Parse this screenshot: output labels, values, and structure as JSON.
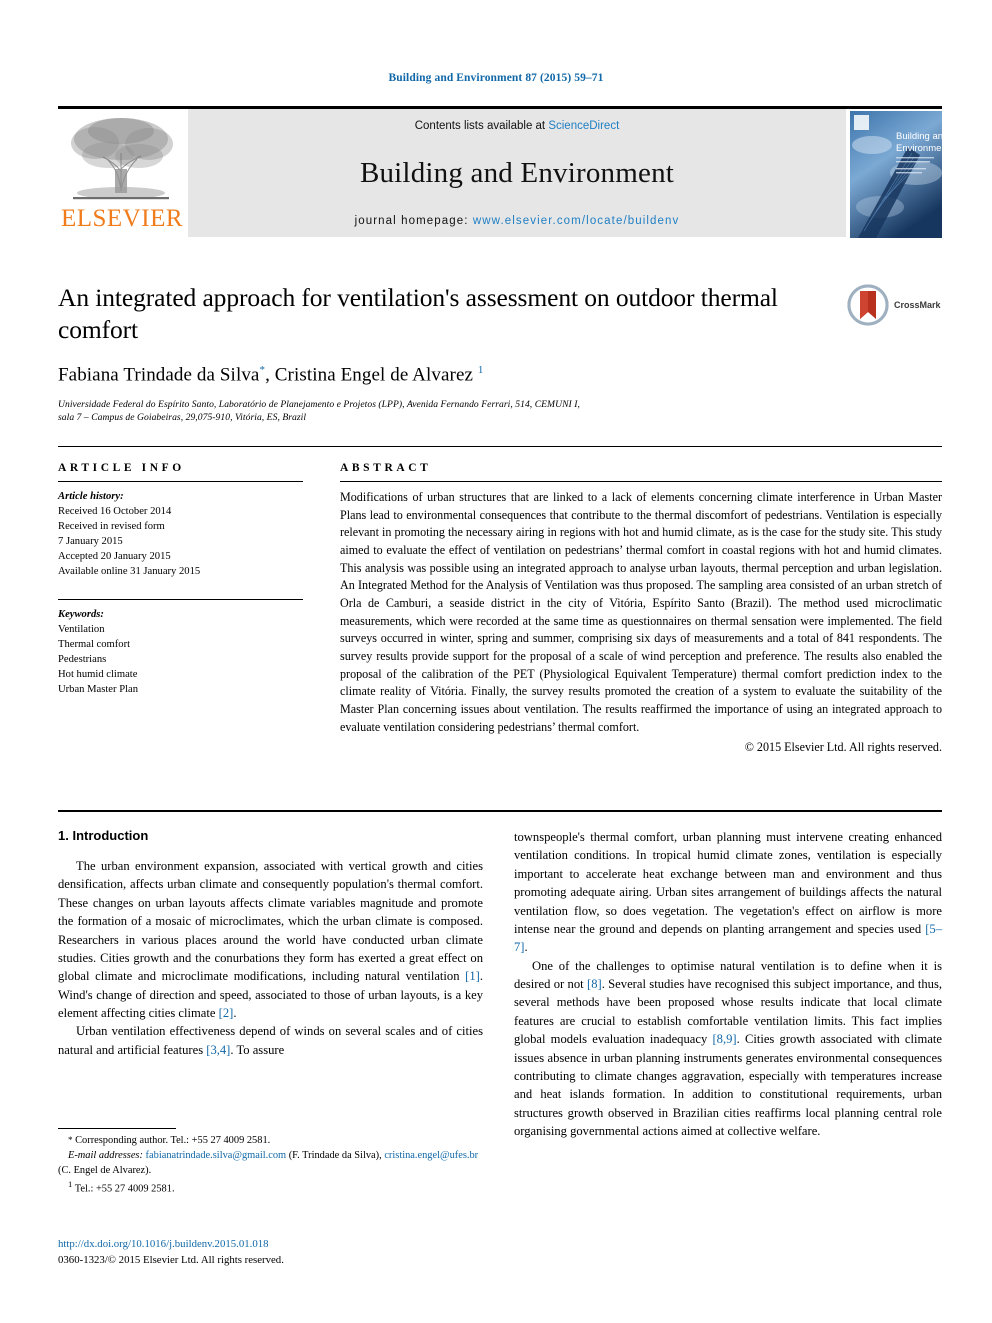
{
  "running_head": "Building and Environment 87 (2015) 59–71",
  "masthead": {
    "publisher_name": "ELSEVIER",
    "contents_prefix": "Contents lists available at ",
    "contents_link": "ScienceDirect",
    "journal_title": "Building and Environment",
    "homepage_prefix": "journal homepage: ",
    "homepage_url": "www.elsevier.com/locate/buildenv",
    "cover_title_line1": "Building and",
    "cover_title_line2": "Environment",
    "accent_color": "#1f7fc4",
    "elsevier_orange": "#f07c1b"
  },
  "title": {
    "text": "An integrated approach for ventilation's assessment on outdoor thermal comfort",
    "crossmark_label": "CrossMark"
  },
  "authors": {
    "author1": "Fabiana Trindade da Silva",
    "author1_mark": "*",
    "separator": ", ",
    "author2": "Cristina Engel de Alvarez",
    "author2_mark": "1",
    "affiliation_line1": "Universidade Federal do Espírito Santo, Laboratório de Planejamento e Projetos (LPP), Avenida Fernando Ferrari, 514, CEMUNI I,",
    "affiliation_line2": "sala 7 – Campus de Goiabeiras, 29,075-910, Vitória, ES, Brazil"
  },
  "article_info": {
    "heading": "ARTICLE INFO",
    "history_label": "Article history:",
    "history": [
      "Received 16 October 2014",
      "Received in revised form",
      "7 January 2015",
      "Accepted 20 January 2015",
      "Available online 31 January 2015"
    ],
    "keywords_label": "Keywords:",
    "keywords": [
      "Ventilation",
      "Thermal comfort",
      "Pedestrians",
      "Hot humid climate",
      "Urban Master Plan"
    ]
  },
  "abstract": {
    "heading": "ABSTRACT",
    "text": "Modifications of urban structures that are linked to a lack of elements concerning climate interference in Urban Master Plans lead to environmental consequences that contribute to the thermal discomfort of pedestrians. Ventilation is especially relevant in promoting the necessary airing in regions with hot and humid climate, as is the case for the study site. This study aimed to evaluate the effect of ventilation on pedestrians’ thermal comfort in coastal regions with hot and humid climates. This analysis was possible using an integrated approach to analyse urban layouts, thermal perception and urban legislation. An Integrated Method for the Analysis of Ventilation was thus proposed. The sampling area consisted of an urban stretch of Orla de Camburi, a seaside district in the city of Vitória, Espírito Santo (Brazil). The method used microclimatic measurements, which were recorded at the same time as questionnaires on thermal sensation were implemented. The field surveys occurred in winter, spring and summer, comprising six days of measurements and a total of 841 respondents. The survey results provide support for the proposal of a scale of wind perception and preference. The results also enabled the proposal of the calibration of the PET (Physiological Equivalent Temperature) thermal comfort prediction index to the climate reality of Vitória. Finally, the survey results promoted the creation of a system to evaluate the suitability of the Master Plan concerning issues about ventilation. The results reaffirmed the importance of using an integrated approach to evaluate ventilation considering pedestrians’ thermal comfort.",
    "copyright": "© 2015 Elsevier Ltd. All rights reserved."
  },
  "introduction": {
    "heading": "1. Introduction",
    "left_paragraphs": [
      "The urban environment expansion, associated with vertical growth and cities densification, affects urban climate and consequently population's thermal comfort. These changes on urban layouts affects climate variables magnitude and promote the formation of a mosaic of microclimates, which the urban climate is composed. Researchers in various places around the world have conducted urban climate studies. Cities growth and the conurbations they form has exerted a great effect on global climate and microclimate modifications, including natural ventilation [1]. Wind's change of direction and speed, associated to those of urban layouts, is a key element affecting cities climate [2].",
      "Urban ventilation effectiveness depend of winds on several scales and of cities natural and artificial features [3,4]. To assure"
    ],
    "right_paragraphs": [
      "townspeople's thermal comfort, urban planning must intervene creating enhanced ventilation conditions. In tropical humid climate zones, ventilation is especially important to accelerate heat exchange between man and environment and thus promoting adequate airing. Urban sites arrangement of buildings affects the natural ventilation flow, so does vegetation. The vegetation's effect on airflow is more intense near the ground and depends on planting arrangement and species used [5–7].",
      "One of the challenges to optimise natural ventilation is to define when it is desired or not [8]. Several studies have recognised this subject importance, and thus, several methods have been proposed whose results indicate that local climate features are crucial to establish comfortable ventilation limits. This fact implies global models evaluation inadequacy [8,9]. Cities growth associated with climate issues absence in urban planning instruments generates environmental consequences contributing to climate changes aggravation, especially with temperatures increase and heat islands formation. In addition to constitutional requirements, urban structures growth observed in Brazilian cities reaffirms local planning central role organising governmental actions aimed at collective welfare."
    ],
    "refs_left": [
      "[1]",
      "[2]",
      "[3,4]"
    ],
    "refs_right": [
      "[5–7]",
      "[8]",
      "[8,9]"
    ]
  },
  "footnotes": {
    "corresponding": "Corresponding author. Tel.: +55 27 4009 2581.",
    "corresponding_mark": "*",
    "email_label": "E-mail addresses:",
    "email1": "fabianatrindade.silva@gmail.com",
    "email1_owner": "(F. Trindade da Silva),",
    "email2": "cristina.engel@ufes.br",
    "email2_owner": "(C. Engel de Alvarez).",
    "footnote1_mark": "1",
    "footnote1": "Tel.: +55 27 4009 2581."
  },
  "doi": {
    "url": "http://dx.doi.org/10.1016/j.buildenv.2015.01.018",
    "issn_line": "0360-1323/© 2015 Elsevier Ltd. All rights reserved."
  }
}
